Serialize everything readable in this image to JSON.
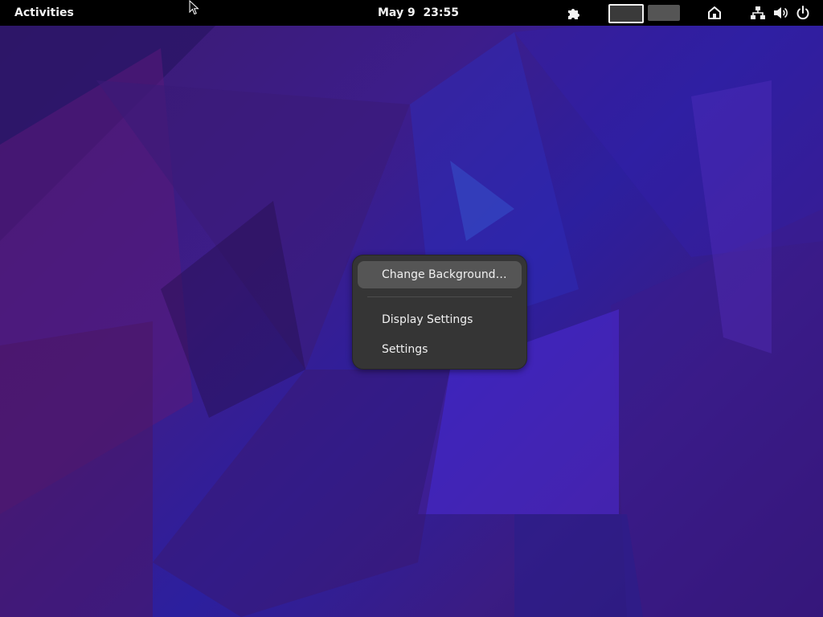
{
  "topbar": {
    "activities_label": "Activities",
    "clock": "May 9  23:55",
    "icons": [
      "extensions-icon",
      "workspace-indicator",
      "home-icon",
      "network-icon",
      "volume-icon",
      "power-icon"
    ]
  },
  "context_menu": {
    "items": [
      {
        "label": "Change Background…",
        "highlighted": true
      },
      {
        "label": "Display Settings",
        "highlighted": false
      },
      {
        "label": "Settings",
        "highlighted": false
      }
    ]
  },
  "colors": {
    "topbar_bg": "#000000",
    "menu_bg": "#353535",
    "menu_highlight": "#555555",
    "wallpaper_primary": "#3d1d8a",
    "wallpaper_accent": "#5a2ad0"
  }
}
